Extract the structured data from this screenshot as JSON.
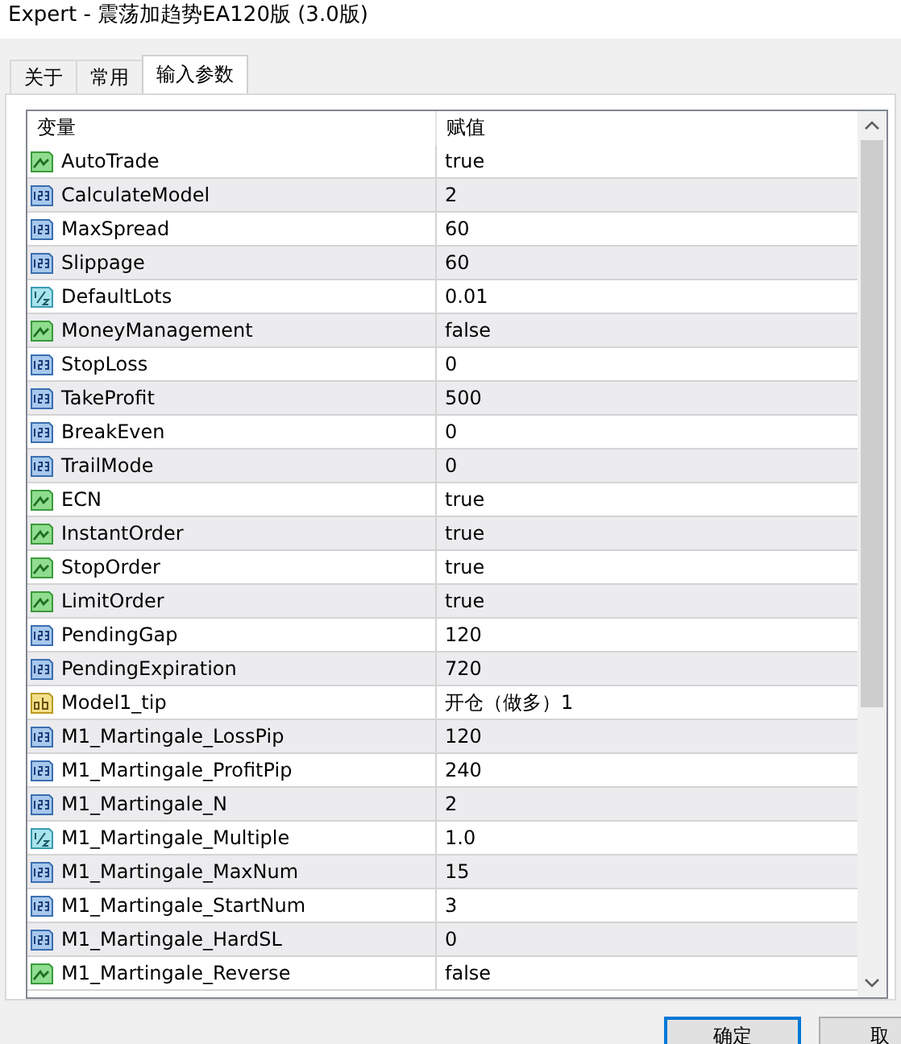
{
  "window": {
    "title": "Expert - 震荡加趋势EA120版 (3.0版)"
  },
  "tabs": [
    {
      "label": "关于",
      "selected": false
    },
    {
      "label": "常用",
      "selected": false
    },
    {
      "label": "输入参数",
      "selected": true
    }
  ],
  "table": {
    "columns": [
      "变量",
      "赋值"
    ],
    "rows": [
      {
        "kind": "bool",
        "name": "AutoTrade",
        "value": "true"
      },
      {
        "kind": "int",
        "name": "CalculateModel",
        "value": "2"
      },
      {
        "kind": "int",
        "name": "MaxSpread",
        "value": "60"
      },
      {
        "kind": "int",
        "name": "Slippage",
        "value": "60"
      },
      {
        "kind": "double",
        "name": "DefaultLots",
        "value": "0.01"
      },
      {
        "kind": "bool",
        "name": "MoneyManagement",
        "value": "false"
      },
      {
        "kind": "int",
        "name": "StopLoss",
        "value": "0"
      },
      {
        "kind": "int",
        "name": "TakeProfit",
        "value": "500"
      },
      {
        "kind": "int",
        "name": "BreakEven",
        "value": "0"
      },
      {
        "kind": "int",
        "name": "TrailMode",
        "value": "0"
      },
      {
        "kind": "bool",
        "name": "ECN",
        "value": "true"
      },
      {
        "kind": "bool",
        "name": "InstantOrder",
        "value": "true"
      },
      {
        "kind": "bool",
        "name": "StopOrder",
        "value": "true"
      },
      {
        "kind": "bool",
        "name": "LimitOrder",
        "value": "true"
      },
      {
        "kind": "int",
        "name": "PendingGap",
        "value": "120"
      },
      {
        "kind": "int",
        "name": "PendingExpiration",
        "value": "720"
      },
      {
        "kind": "string",
        "name": "Model1_tip",
        "value": "开仓（做多）1"
      },
      {
        "kind": "int",
        "name": "M1_Martingale_LossPip",
        "value": "120"
      },
      {
        "kind": "int",
        "name": "M1_Martingale_ProfitPip",
        "value": "240"
      },
      {
        "kind": "int",
        "name": "M1_Martingale_N",
        "value": "2"
      },
      {
        "kind": "double",
        "name": "M1_Martingale_Multiple",
        "value": "1.0"
      },
      {
        "kind": "int",
        "name": "M1_Martingale_MaxNum",
        "value": "15"
      },
      {
        "kind": "int",
        "name": "M1_Martingale_StartNum",
        "value": "3"
      },
      {
        "kind": "int",
        "name": "M1_Martingale_HardSL",
        "value": "0"
      },
      {
        "kind": "bool",
        "name": "M1_Martingale_Reverse",
        "value": "false"
      }
    ]
  },
  "buttons": [
    "确定",
    "取"
  ]
}
